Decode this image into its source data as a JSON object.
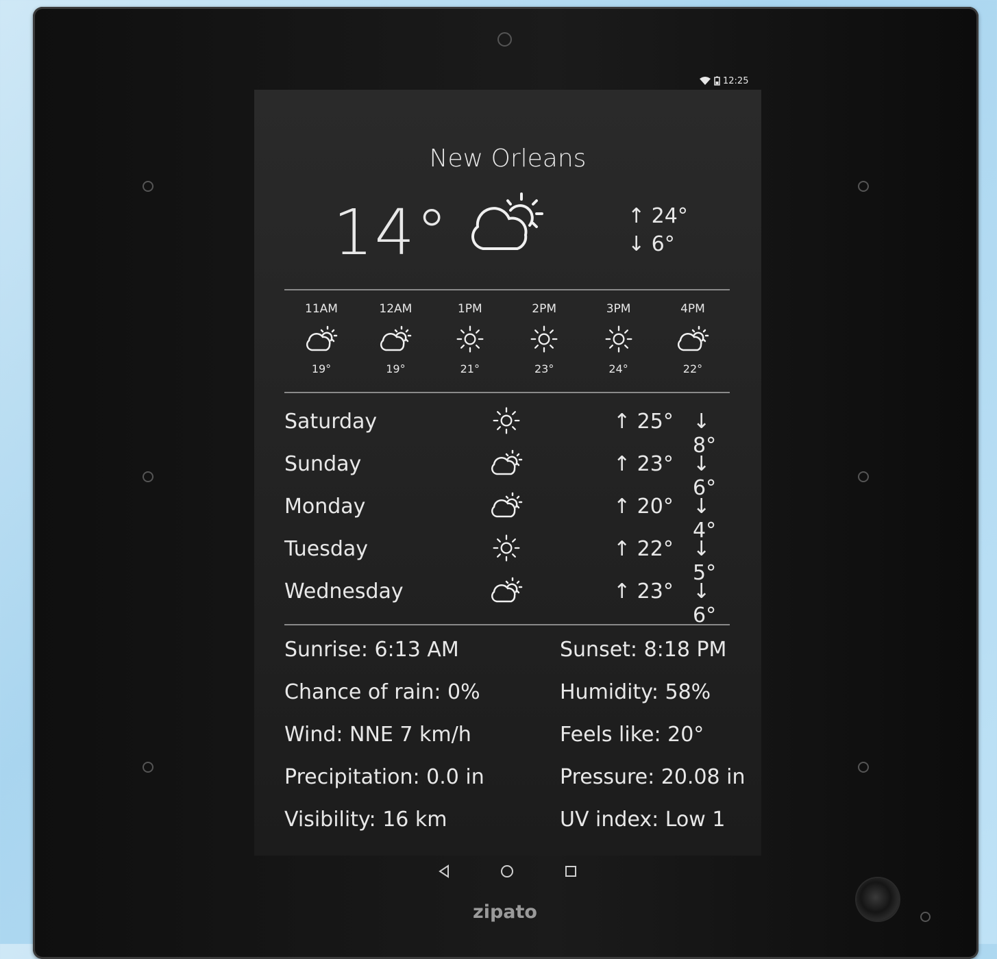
{
  "status": {
    "time": "12:25",
    "icons": [
      "wifi-icon",
      "battery-icon"
    ]
  },
  "current": {
    "city": "New Orleans",
    "temp": "14°",
    "icon": "cloud-sun-icon",
    "high": "↑ 24°",
    "low": "↓ 6°"
  },
  "hourly": [
    {
      "time": "11AM",
      "icon": "cloud-sun-icon",
      "temp": "19°"
    },
    {
      "time": "12AM",
      "icon": "cloud-sun-icon",
      "temp": "19°"
    },
    {
      "time": "1PM",
      "icon": "sun-icon",
      "temp": "21°"
    },
    {
      "time": "2PM",
      "icon": "sun-icon",
      "temp": "23°"
    },
    {
      "time": "3PM",
      "icon": "sun-icon",
      "temp": "24°"
    },
    {
      "time": "4PM",
      "icon": "cloud-sun-icon",
      "temp": "22°"
    }
  ],
  "daily": [
    {
      "day": "Saturday",
      "icon": "sun-icon",
      "high": "↑ 25°",
      "low": "↓ 8°"
    },
    {
      "day": "Sunday",
      "icon": "cloud-sun-icon",
      "high": "↑ 23°",
      "low": "↓ 6°"
    },
    {
      "day": "Monday",
      "icon": "cloud-sun-icon",
      "high": "↑ 20°",
      "low": "↓ 4°"
    },
    {
      "day": "Tuesday",
      "icon": "sun-icon",
      "high": "↑ 22°",
      "low": "↓ 5°"
    },
    {
      "day": "Wednesday",
      "icon": "cloud-sun-icon",
      "high": "↑ 23°",
      "low": "↓ 6°"
    }
  ],
  "details": {
    "sunrise": "Sunrise: 6:13 AM",
    "sunset": "Sunset: 8:18 PM",
    "rain": "Chance of rain: 0%",
    "humidity": "Humidity: 58%",
    "wind": "Wind: NNE 7 km/h",
    "feels": "Feels like: 20°",
    "precipitation": "Precipitation: 0.0 in",
    "pressure": "Pressure: 20.08 in",
    "visibility": "Visibility: 16 km",
    "uv": "UV index: Low 1"
  },
  "nav": {
    "back": "back-icon",
    "home": "home-icon",
    "recents": "recents-icon"
  },
  "brand": "zipato",
  "colors": {
    "screen_bg": "#232323",
    "text": "#e8e8e8",
    "wall": "#bfe2f6"
  }
}
